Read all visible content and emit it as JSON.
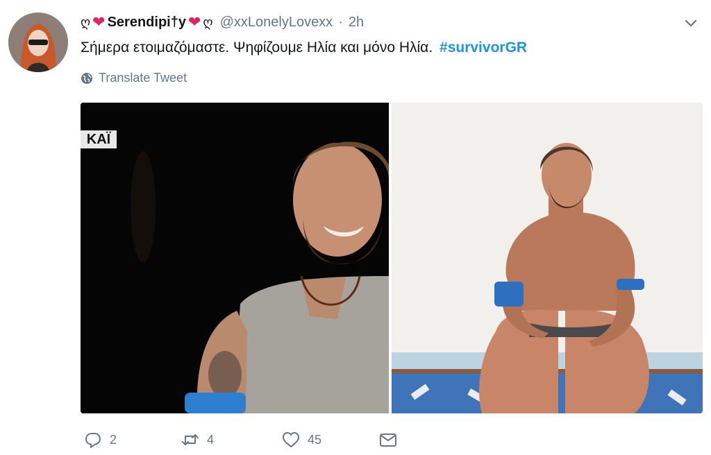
{
  "tweet": {
    "display_name": "Serendipi†y",
    "name_decor_left": "ღ",
    "name_decor_right": "ღ",
    "handle": "@xxLonelyLovexx",
    "separator": "·",
    "timestamp": "2h",
    "text": "Σήμερα ετοιμαζόμαστε. Ψηφίζουμε Ηλία και μόνο Ηλία.",
    "hashtag": "#survivorGR",
    "translate_label": "Translate Tweet",
    "media_watermark": "ΚΑΪ"
  },
  "actions": {
    "reply_count": "2",
    "retweet_count": "4",
    "like_count": "45"
  },
  "icons": [
    "caret-down-icon",
    "globe-icon",
    "reply-icon",
    "retweet-icon",
    "like-icon",
    "direct-message-icon"
  ],
  "colors": {
    "heart": "#e0245e",
    "hashtag": "#1b95e0",
    "secondary_text": "#657786",
    "primary_text": "#14171a"
  }
}
